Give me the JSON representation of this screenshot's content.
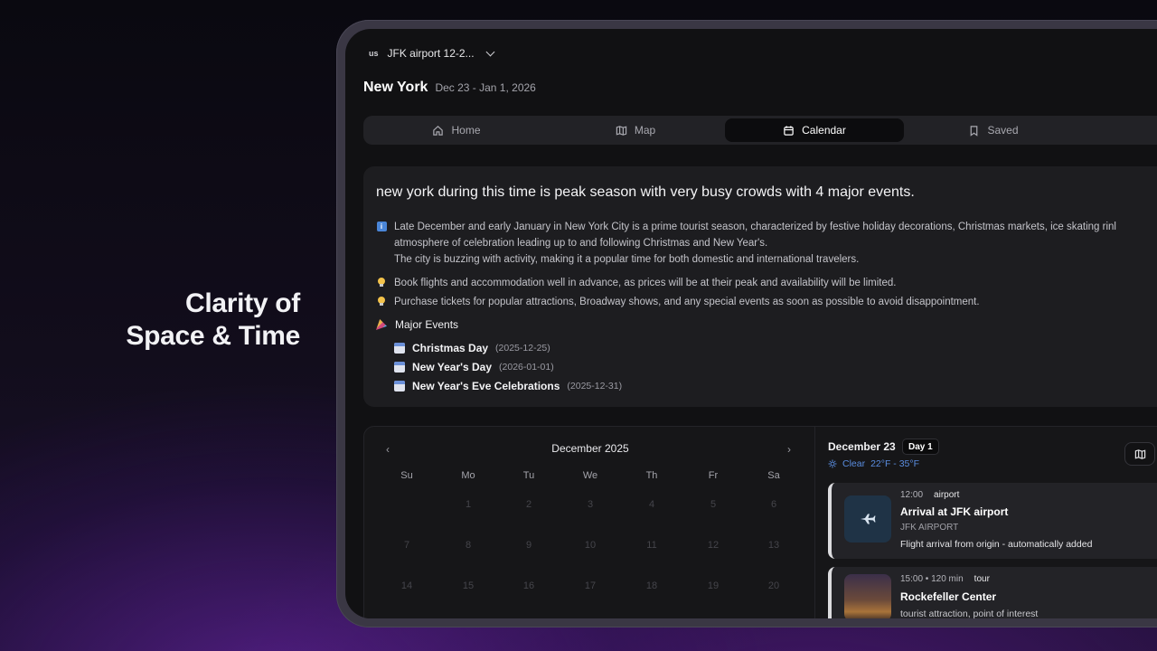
{
  "tagline": {
    "line1": "Clarity of",
    "line2": "Space & Time"
  },
  "trip": {
    "flag": "us",
    "name": "JFK airport 12-2..."
  },
  "destination": {
    "city": "New York",
    "dates": "Dec 23 - Jan 1, 2026"
  },
  "tabs": [
    {
      "label": "Home",
      "icon": "home-icon"
    },
    {
      "label": "Map",
      "icon": "map-icon"
    },
    {
      "label": "Calendar",
      "icon": "calendar-icon",
      "active": true
    },
    {
      "label": "Saved",
      "icon": "bookmark-icon"
    }
  ],
  "summary": {
    "headline": "new york during this time is peak season with very busy crowds with 4 major events.",
    "info_line1": "Late December and early January in New York City is a prime tourist season, characterized by festive holiday decorations, Christmas markets, ice skating rinl",
    "info_line2": "atmosphere of celebration leading up to and following Christmas and New Year's.",
    "info_line3": "The city is buzzing with activity, making it a popular time for both domestic and international travelers.",
    "tips": [
      "Book flights and accommodation well in advance, as prices will be at their peak and availability will be limited.",
      "Purchase tickets for popular attractions, Broadway shows, and any special events as soon as possible to avoid disappointment."
    ],
    "events_title": "Major Events",
    "events": [
      {
        "name": "Christmas Day",
        "date": "(2025-12-25)"
      },
      {
        "name": "New Year's Day",
        "date": "(2026-01-01)"
      },
      {
        "name": "New Year's Eve Celebrations",
        "date": "(2025-12-31)"
      }
    ]
  },
  "calendar": {
    "month": "December 2025",
    "weekdays": [
      "Su",
      "Mo",
      "Tu",
      "We",
      "Th",
      "Fr",
      "Sa"
    ],
    "weeks": [
      [
        "",
        "1",
        "2",
        "3",
        "4",
        "5",
        "6"
      ],
      [
        "7",
        "8",
        "9",
        "10",
        "11",
        "12",
        "13"
      ],
      [
        "14",
        "15",
        "16",
        "17",
        "18",
        "19",
        "20"
      ]
    ]
  },
  "day": {
    "date": "December 23",
    "badge": "Day 1",
    "weather_condition": "Clear",
    "weather_temp": "22°F - 35°F",
    "items": [
      {
        "time": "12:00",
        "category": "airport",
        "title": "Arrival at JFK airport",
        "subtitle": "JFK AIRPORT",
        "desc": "Flight arrival from origin - automatically added"
      },
      {
        "time": "15:00 • 120 min",
        "category": "tour",
        "title": "Rockefeller Center",
        "subtitle": "",
        "desc": "tourist attraction, point of interest"
      }
    ]
  },
  "colors": {
    "accent_blue": "#5a8de0",
    "background": "#111113",
    "purple_glow": "#7828be"
  }
}
